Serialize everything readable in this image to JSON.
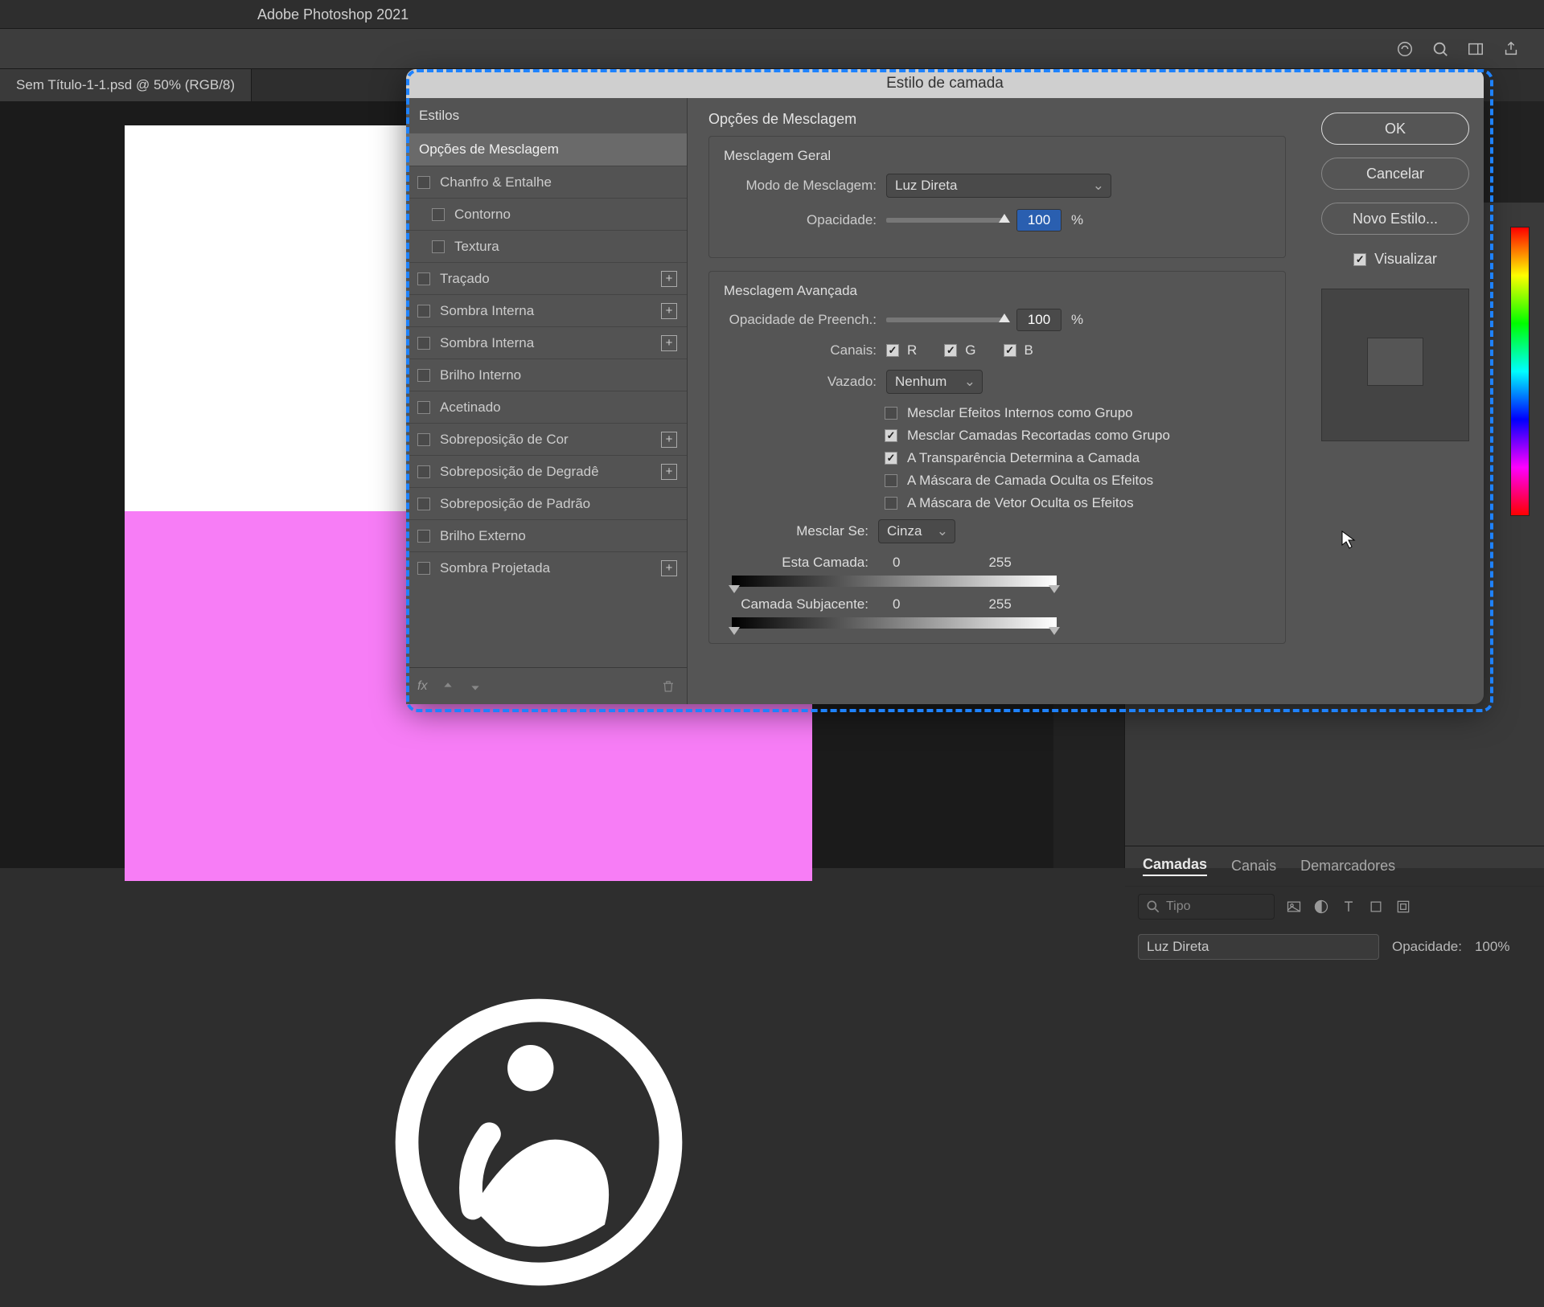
{
  "app_title": "Adobe Photoshop 2021",
  "tab": "Sem Título-1-1.psd @ 50% (RGB/8)",
  "dialog": {
    "title": "Estilo de camada",
    "styles_header": "Estilos",
    "selected_style": "Opções de Mesclagem",
    "styles": [
      {
        "label": "Chanfro & Entalhe",
        "plus": false,
        "indent": 0
      },
      {
        "label": "Contorno",
        "plus": false,
        "indent": 1
      },
      {
        "label": "Textura",
        "plus": false,
        "indent": 1
      },
      {
        "label": "Traçado",
        "plus": true,
        "indent": 0
      },
      {
        "label": "Sombra Interna",
        "plus": true,
        "indent": 0
      },
      {
        "label": "Sombra Interna",
        "plus": true,
        "indent": 0
      },
      {
        "label": "Brilho Interno",
        "plus": false,
        "indent": 0
      },
      {
        "label": "Acetinado",
        "plus": false,
        "indent": 0
      },
      {
        "label": "Sobreposição de Cor",
        "plus": true,
        "indent": 0
      },
      {
        "label": "Sobreposição de Degradê",
        "plus": true,
        "indent": 0
      },
      {
        "label": "Sobreposição de Padrão",
        "plus": false,
        "indent": 0
      },
      {
        "label": "Brilho Externo",
        "plus": false,
        "indent": 0
      },
      {
        "label": "Sombra Projetada",
        "plus": true,
        "indent": 0
      }
    ],
    "footer_fx": "fx",
    "section_title": "Opções de Mesclagem",
    "general": {
      "title": "Mesclagem Geral",
      "mode_label": "Modo de Mesclagem:",
      "mode_value": "Luz Direta",
      "opacity_label": "Opacidade:",
      "opacity_value": "100",
      "pct": "%"
    },
    "advanced": {
      "title": "Mesclagem Avançada",
      "fill_label": "Opacidade de Preench.:",
      "fill_value": "100",
      "pct": "%",
      "channels_label": "Canais:",
      "ch_r": "R",
      "ch_g": "G",
      "ch_b": "B",
      "knockout_label": "Vazado:",
      "knockout_value": "Nenhum",
      "opts": [
        "Mesclar Efeitos Internos como Grupo",
        "Mesclar Camadas Recortadas como Grupo",
        "A Transparência Determina a Camada",
        "A Máscara de Camada Oculta os Efeitos",
        "A Máscara de Vetor Oculta os Efeitos"
      ],
      "opts_on": [
        false,
        true,
        true,
        false,
        false
      ]
    },
    "blendif": {
      "label": "Mesclar Se:",
      "value": "Cinza",
      "this_label": "Esta Camada:",
      "this_low": "0",
      "this_high": "255",
      "under_label": "Camada Subjacente:",
      "under_low": "0",
      "under_high": "255"
    },
    "buttons": {
      "ok": "OK",
      "cancel": "Cancelar",
      "newstyle": "Novo Estilo...",
      "preview": "Visualizar"
    }
  },
  "layers": {
    "tabs": [
      "Camadas",
      "Canais",
      "Demarcadores"
    ],
    "type_placeholder": "Tipo",
    "blend_value": "Luz Direta",
    "opacity_label": "Opacidade:",
    "opacity_value": "100%"
  }
}
